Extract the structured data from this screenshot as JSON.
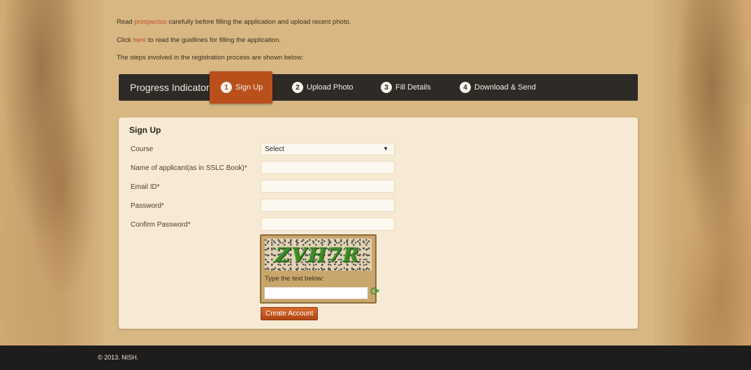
{
  "intro": {
    "line1_before": "Read ",
    "line1_link": "prospectus",
    "line1_after": " carefully before filling the application and upload recent photo.",
    "line2_before": "Click ",
    "line2_link": "here",
    "line2_after": " to read the guidlines for filling the application.",
    "line3": "The steps involved in the registration process are shown below:"
  },
  "progress": {
    "title": "Progress Indicator",
    "steps": [
      {
        "num": "1",
        "label": "Sign Up",
        "active": true
      },
      {
        "num": "2",
        "label": "Upload Photo",
        "active": false
      },
      {
        "num": "3",
        "label": "Fill Details",
        "active": false
      },
      {
        "num": "4",
        "label": "Download & Send",
        "active": false
      }
    ]
  },
  "form": {
    "title": "Sign Up",
    "course_label": "Course",
    "course_value": "Select",
    "name_label": "Name of applicant(as in SSLC Book)*",
    "email_label": "Email ID*",
    "password_label": "Password*",
    "confirm_label": "Confirm Password*",
    "captcha_text": "ZVH7R",
    "captcha_prompt": "Type the text below:",
    "submit_label": "Create Account"
  },
  "footer": {
    "copyright": "© 2013. NISH."
  },
  "colors": {
    "accent": "#b9501c",
    "bar": "#2e2a26",
    "link": "#c0502a",
    "card": "#f7ead4"
  }
}
